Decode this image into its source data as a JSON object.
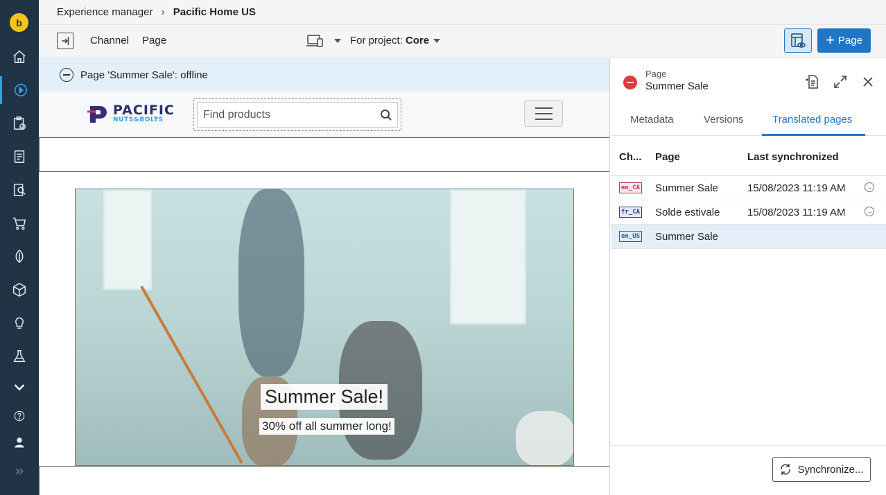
{
  "breadcrumb": {
    "root": "Experience manager",
    "separator": "›",
    "current": "Pacific Home US"
  },
  "toolbar": {
    "channel_label": "Channel",
    "page_label": "Page",
    "project_prefix": "For project:",
    "project_value": "Core",
    "add_page_label": "Page"
  },
  "status": {
    "text": "Page 'Summer Sale': offline"
  },
  "site": {
    "logo_line1": "PACIFIC",
    "logo_line2": "NUTS&BOLTS",
    "search_placeholder": "Find products"
  },
  "hero": {
    "title": "Summer Sale!",
    "subtitle": "30% off all summer long!"
  },
  "panel": {
    "kicker": "Page",
    "title": "Summer Sale",
    "tabs": [
      "Metadata",
      "Versions",
      "Translated pages"
    ],
    "active_tab": "Translated pages",
    "columns": [
      "Ch...",
      "Page",
      "Last synchronized"
    ],
    "rows": [
      {
        "channel": "en_CA",
        "page": "Summer Sale",
        "last_sync": "15/08/2023 11:19 AM"
      },
      {
        "channel": "fr_CA",
        "page": "Solde estivale",
        "last_sync": "15/08/2023 11:19 AM"
      },
      {
        "channel": "en_US",
        "page": "Summer Sale",
        "last_sync": ""
      }
    ],
    "sync_button": "Synchronize..."
  },
  "colors": {
    "sidebar_bg": "#213446",
    "accent": "#1f76c6",
    "offline": "#e23a3a",
    "banner_bg": "#e3f0fa"
  },
  "icons": {
    "sidebar": [
      "app-logo",
      "home-icon",
      "experience-manager-icon",
      "clipboard-check-icon",
      "document-icon",
      "search-document-icon",
      "cart-icon",
      "leaf-icon",
      "cube-icon",
      "lightbulb-icon",
      "flask-icon",
      "chevron-down-icon",
      "help-icon",
      "user-icon",
      "expand-icon"
    ]
  }
}
